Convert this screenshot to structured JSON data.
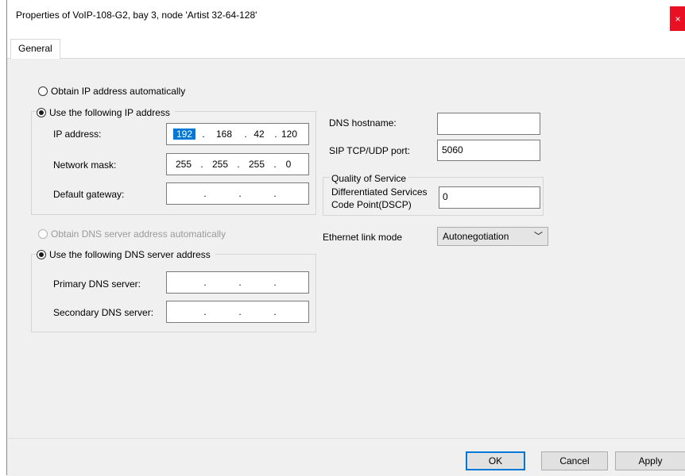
{
  "window": {
    "title": "Properties of VoIP-108-G2, bay 3, node 'Artist 32-64-128'",
    "close_icon": "close-icon",
    "close_glyph": "×"
  },
  "tabs": [
    {
      "label": "General",
      "selected": true
    }
  ],
  "ip": {
    "auto_label": "Obtain IP address automatically",
    "auto_checked": false,
    "manual_label": "Use the following IP address",
    "manual_checked": true,
    "address_label": "IP address:",
    "address": [
      "192",
      "168",
      "42",
      "120"
    ],
    "mask_label": "Network mask:",
    "mask": [
      "255",
      "255",
      "255",
      "0"
    ],
    "gateway_label": "Default gateway:",
    "gateway": [
      "",
      "",
      "",
      ""
    ]
  },
  "dns": {
    "auto_label": "Obtain DNS server address automatically",
    "auto_enabled": false,
    "manual_label": "Use the following DNS server address",
    "manual_checked": true,
    "primary_label": "Primary DNS server:",
    "primary": [
      "",
      "",
      "",
      ""
    ],
    "secondary_label": "Secondary DNS server:",
    "secondary": [
      "",
      "",
      "",
      ""
    ]
  },
  "right": {
    "hostname_label": "DNS hostname:",
    "hostname_value": "",
    "sip_label": "SIP TCP/UDP port:",
    "sip_value": "5060",
    "qos_title": "Quality of Service",
    "dscp_label_line1": "Differentiated Services",
    "dscp_label_line2": "Code Point(DSCP)",
    "dscp_value": "0",
    "eth_label": "Ethernet link mode",
    "eth_value": "Autonegotiation",
    "eth_chevron": "﹀"
  },
  "footer": {
    "ok_label": "OK",
    "cancel_label": "Cancel",
    "apply_label": "Apply"
  },
  "ip_separator": "."
}
